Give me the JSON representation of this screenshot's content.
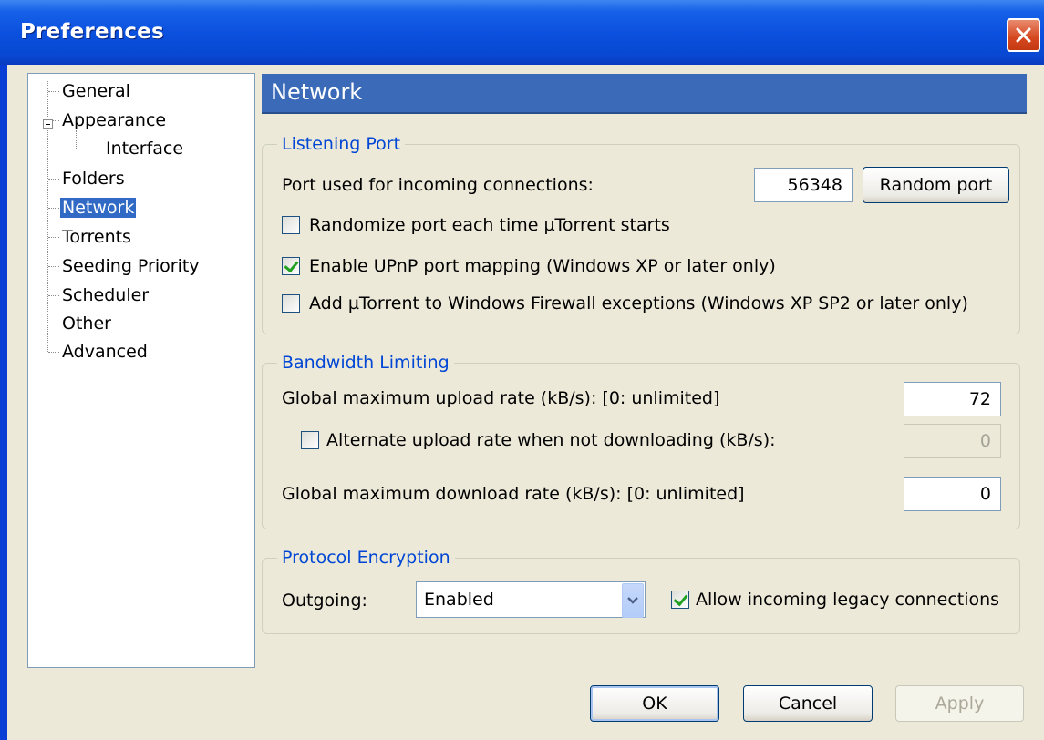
{
  "window": {
    "title": "Preferences"
  },
  "sidebar": {
    "items": [
      {
        "label": "General"
      },
      {
        "label": "Appearance"
      },
      {
        "label": "Interface"
      },
      {
        "label": "Folders"
      },
      {
        "label": "Network"
      },
      {
        "label": "Torrents"
      },
      {
        "label": "Seeding Priority"
      },
      {
        "label": "Scheduler"
      },
      {
        "label": "Other"
      },
      {
        "label": "Advanced"
      }
    ],
    "selected": "Network"
  },
  "main": {
    "header": "Network",
    "listening_port": {
      "title": "Listening Port",
      "port_label": "Port used for incoming connections:",
      "port_value": "56348",
      "random_port_button": "Random port",
      "randomize_label": "Randomize port each time µTorrent starts",
      "randomize_checked": false,
      "upnp_label": "Enable UPnP port mapping (Windows XP or later only)",
      "upnp_checked": true,
      "firewall_label": "Add µTorrent to Windows Firewall exceptions (Windows XP SP2 or later only)",
      "firewall_checked": false
    },
    "bandwidth": {
      "title": "Bandwidth Limiting",
      "upload_label": "Global maximum upload rate (kB/s): [0: unlimited]",
      "upload_value": "72",
      "alt_upload_label": "Alternate upload rate when not downloading (kB/s):",
      "alt_upload_checked": false,
      "alt_upload_value": "0",
      "download_label": "Global maximum download rate (kB/s): [0: unlimited]",
      "download_value": "0"
    },
    "encryption": {
      "title": "Protocol Encryption",
      "outgoing_label": "Outgoing:",
      "outgoing_value": "Enabled",
      "legacy_label": "Allow incoming legacy connections",
      "legacy_checked": true
    }
  },
  "footer": {
    "ok": "OK",
    "cancel": "Cancel",
    "apply": "Apply"
  },
  "colors": {
    "titlebar": "#0a4fdd",
    "header": "#3a6ab8",
    "selection": "#316ac5",
    "group_title": "#0046d5",
    "dialog_bg": "#ece9d8"
  }
}
